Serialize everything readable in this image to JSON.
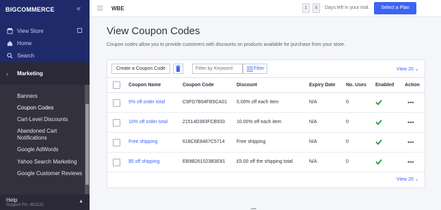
{
  "sidebar": {
    "logo": "BIGCOMMERCE",
    "collapse_icon": "double-chevron-left-icon",
    "links": [
      {
        "label": "View Store",
        "icon": "storefront-icon"
      },
      {
        "label": "Home",
        "icon": "home-icon"
      },
      {
        "label": "Search",
        "icon": "search-icon"
      }
    ],
    "section": "Marketing",
    "items": [
      {
        "label": "Banners",
        "active": false
      },
      {
        "label": "Coupon Codes",
        "active": true
      },
      {
        "label": "Cart-Level Discounts",
        "active": false
      },
      {
        "label": "Abandoned Cart Notifications",
        "active": false
      },
      {
        "label": "Google AdWords",
        "active": false
      },
      {
        "label": "Yahoo Search Marketing",
        "active": false
      },
      {
        "label": "Google Customer Reviews",
        "active": false
      }
    ],
    "help": "Help",
    "support_pin": "Support Pin: 853122"
  },
  "topbar": {
    "store_name": "WBE",
    "days": [
      "1",
      "5"
    ],
    "trial_text": "Days left in your trial.",
    "plan_button": "Select a Plan"
  },
  "main": {
    "title": "View Coupon Codes",
    "description": "Coupon codes allow you to provide customers with discounts on products available for purchase from your store.",
    "create_button": "Create a Coupon Code",
    "search_placeholder": "Filter by Keyword",
    "filter_button": "Filter",
    "view_count": "View 20",
    "columns": [
      "Coupon Name",
      "Coupon Code",
      "Discount",
      "Expiry Date",
      "No. Uses",
      "Enabled",
      "Action"
    ],
    "rows": [
      {
        "name": "5% off order total",
        "code": "C9FD7B64FB5CA01",
        "discount": "5.00% off each item",
        "expiry": "N/A",
        "uses": "0",
        "enabled": true
      },
      {
        "name": "10% off order total",
        "code": "21514D383FCB933",
        "discount": "10.00% off each item",
        "expiry": "N/A",
        "uses": "0",
        "enabled": true
      },
      {
        "name": "Free shipping",
        "code": "618C6E8467C5714",
        "discount": "Free shipping",
        "expiry": "N/A",
        "uses": "0",
        "enabled": true
      },
      {
        "name": "$5 off shipping",
        "code": "EB9B261023B3E81",
        "discount": "£5.00 off the shipping total",
        "expiry": "N/A",
        "uses": "0",
        "enabled": true
      }
    ]
  },
  "colors": {
    "sidebar": "#34313f",
    "sidebar_top": "#1f2a6b",
    "accent": "#3c64f4",
    "enabled": "#2e9e4a"
  }
}
